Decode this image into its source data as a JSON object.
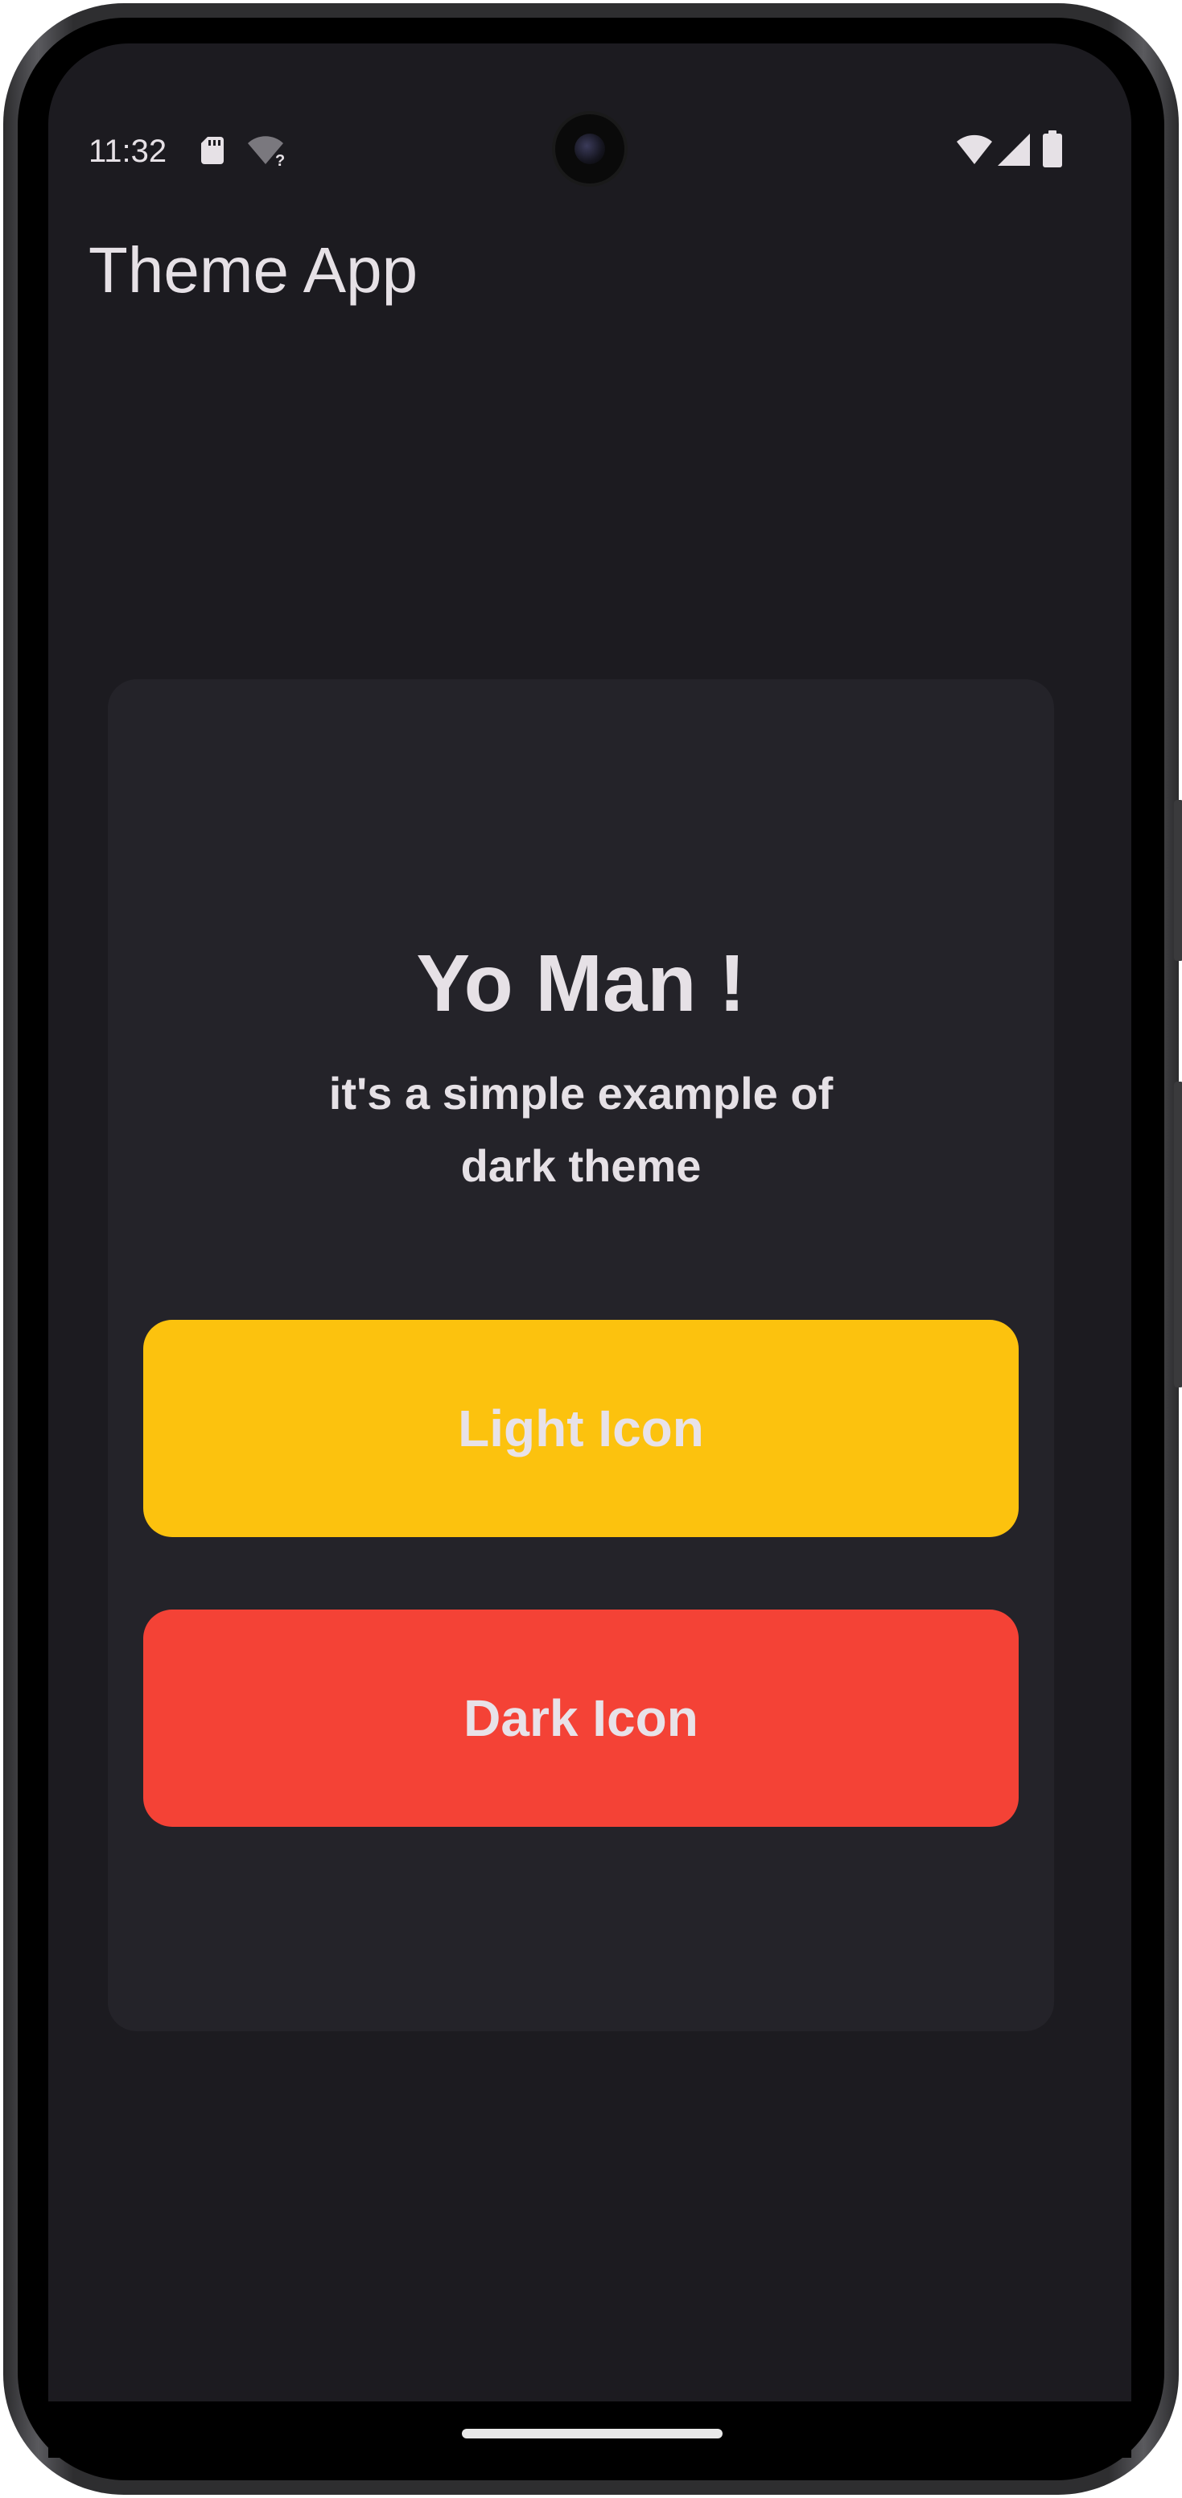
{
  "status_bar": {
    "time": "11:32",
    "icons_left": [
      "sd-card-icon",
      "wifi-unknown-icon"
    ],
    "icons_right": [
      "wifi-icon",
      "cellular-signal-icon",
      "battery-icon"
    ]
  },
  "app_bar": {
    "title": "Theme App"
  },
  "card": {
    "title": "Yo Man !",
    "subtitle": "it's a simple example of dark theme",
    "light_button_label": "Light Icon",
    "dark_button_label": "Dark Icon"
  },
  "colors": {
    "background": "#1c1b20",
    "card": "#242329",
    "text": "#e6e1e6",
    "light_button": "#fcc20e",
    "dark_button": "#f44236"
  }
}
